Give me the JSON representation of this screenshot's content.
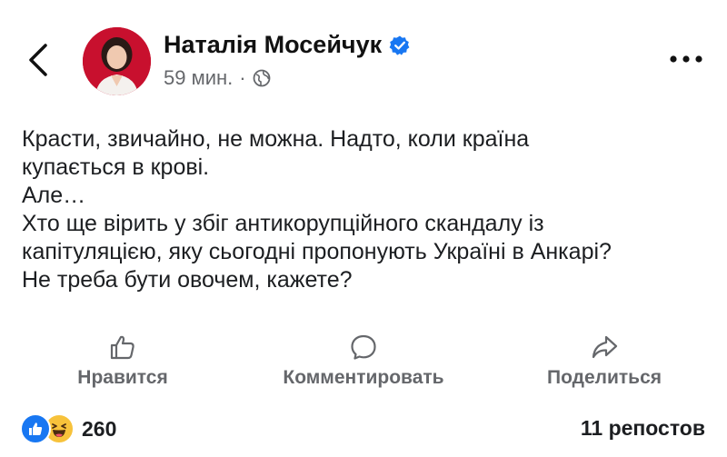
{
  "post": {
    "author": "Наталія Мосейчук",
    "time": "59 мин.",
    "separator": "·",
    "lines": [
      "Красти, звичайно, не можна. Надто, коли країна",
      "купається в крові.",
      "Але…",
      "Хто ще вірить у збіг антикорупційного скандалу із",
      "капітуляцією, яку сьогодні пропонують Україні в Анкарі?",
      "Не треба бути овочем, кажете?"
    ]
  },
  "actions": {
    "like": "Нравится",
    "comment": "Комментировать",
    "share": "Поделиться"
  },
  "stats": {
    "reactions_count": "260",
    "reposts": "11 репостов"
  },
  "colors": {
    "verified": "#1877f2",
    "like_reaction": "#1877f2",
    "haha_reaction": "#f7c23b",
    "avatar_background": "#c8102e",
    "muted_text": "#65676b"
  },
  "icons": [
    "back-chevron-icon",
    "verified-badge-icon",
    "globe-icon",
    "more-options-icon",
    "like-icon",
    "comment-icon",
    "share-icon",
    "like-reaction-icon",
    "haha-reaction-icon"
  ]
}
